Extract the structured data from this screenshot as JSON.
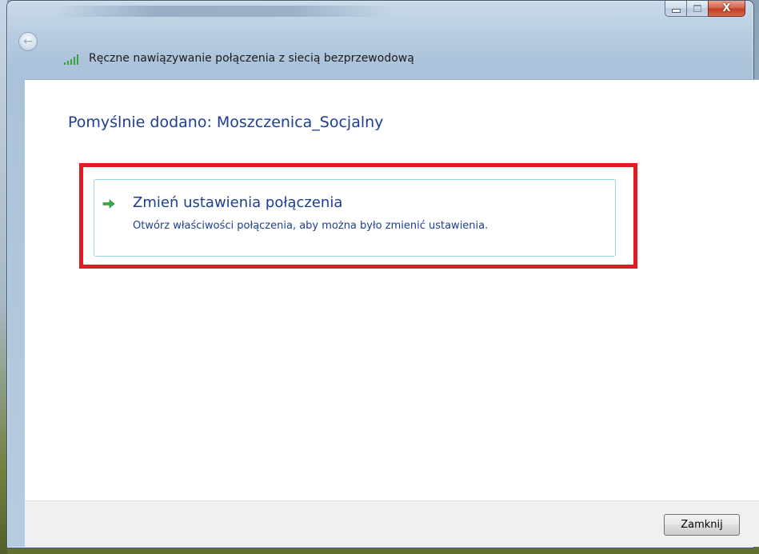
{
  "window": {
    "title": "Ręczne nawiązywanie połączenia z siecią bezprzewodową",
    "caption_buttons": {
      "minimize_icon": "minimize-icon",
      "maximize_icon": "maximize-icon",
      "close_label": "X"
    },
    "back_icon": "back-arrow-icon",
    "network_icon": "wireless-signal-icon"
  },
  "content": {
    "heading": "Pomyślnie dodano: Moszczenica_Socjalny",
    "option": {
      "icon": "green-arrow-icon",
      "title": "Zmień ustawienia połączenia",
      "description": "Otwórz właściwości połączenia, aby można było zmienić ustawienia."
    }
  },
  "footer": {
    "close_label": "Zamknij"
  },
  "colors": {
    "heading": "#1e3e96",
    "highlight_border": "#e01d24",
    "option_border": "#98d5e8",
    "arrow": "#2eae3c"
  }
}
